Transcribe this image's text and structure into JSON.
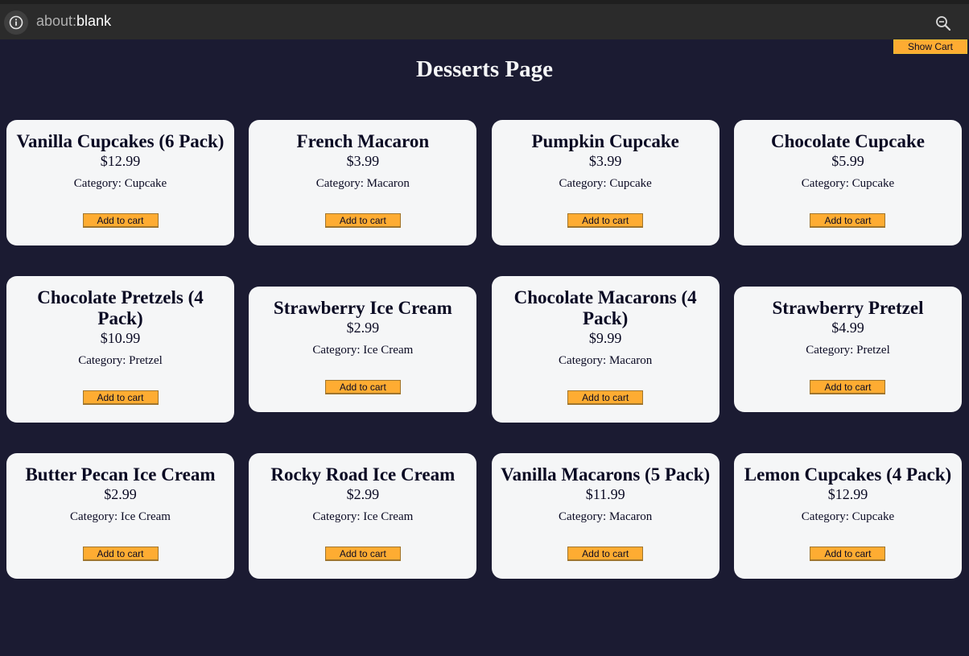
{
  "browser": {
    "url_scheme": "about:",
    "url_path": "blank",
    "info_icon": "info-icon",
    "zoom_icon": "zoom-icon"
  },
  "cart": {
    "show_label": "Show Cart"
  },
  "page": {
    "title": "Desserts Page"
  },
  "products": [
    {
      "name": "Vanilla Cupcakes (6 Pack)",
      "price": "$12.99",
      "category": "Category: Cupcake",
      "button": "Add to cart"
    },
    {
      "name": "French Macaron",
      "price": "$3.99",
      "category": "Category: Macaron",
      "button": "Add to cart"
    },
    {
      "name": "Pumpkin Cupcake",
      "price": "$3.99",
      "category": "Category: Cupcake",
      "button": "Add to cart"
    },
    {
      "name": "Chocolate Cupcake",
      "price": "$5.99",
      "category": "Category: Cupcake",
      "button": "Add to cart"
    },
    {
      "name": "Chocolate Pretzels (4 Pack)",
      "price": "$10.99",
      "category": "Category: Pretzel",
      "button": "Add to cart"
    },
    {
      "name": "Strawberry Ice Cream",
      "price": "$2.99",
      "category": "Category: Ice Cream",
      "button": "Add to cart"
    },
    {
      "name": "Chocolate Macarons (4 Pack)",
      "price": "$9.99",
      "category": "Category: Macaron",
      "button": "Add to cart"
    },
    {
      "name": "Strawberry Pretzel",
      "price": "$4.99",
      "category": "Category: Pretzel",
      "button": "Add to cart"
    },
    {
      "name": "Butter Pecan Ice Cream",
      "price": "$2.99",
      "category": "Category: Ice Cream",
      "button": "Add to cart"
    },
    {
      "name": "Rocky Road Ice Cream",
      "price": "$2.99",
      "category": "Category: Ice Cream",
      "button": "Add to cart"
    },
    {
      "name": "Vanilla Macarons (5 Pack)",
      "price": "$11.99",
      "category": "Category: Macaron",
      "button": "Add to cart"
    },
    {
      "name": "Lemon Cupcakes (4 Pack)",
      "price": "$12.99",
      "category": "Category: Cupcake",
      "button": "Add to cart"
    }
  ],
  "colors": {
    "background": "#1b1b32",
    "card": "#f5f6f7",
    "button": "#feac32",
    "text": "#0a0a23"
  }
}
